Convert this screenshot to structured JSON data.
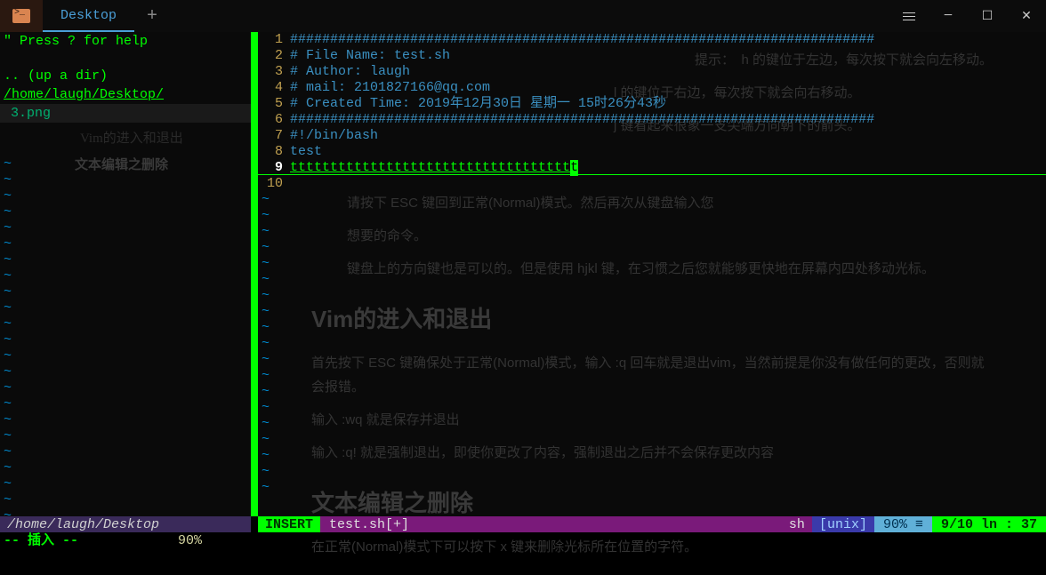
{
  "titlebar": {
    "tab_label": "Desktop",
    "add_symbol": "+"
  },
  "left_pane": {
    "help": "\" Press ? for help",
    "up_dir": ".. (up a dir)",
    "cwd": "/home/laugh/Desktop/",
    "file": "3.png",
    "status_path": "/home/laugh/Desktop",
    "bottom_msg": "-- 插入 --",
    "bottom_pct": "90%"
  },
  "bg_doc": {
    "hint1": "提示：　h 的键位于左边，每次按下就会向左移动。",
    "hint2": "l 的键位于右边，每次按下就会向右移动。",
    "hint3": "j 键看起来很象一支尖端方向朝下的箭头。",
    "nav1": "Vim的进入和退出",
    "nav2": "文本编辑之删除",
    "p1": "请按下 ESC 键回到正常(Normal)模式。然后再次从键盘输入您",
    "p2": "想要的命令。",
    "p3": "键盘上的方向键也是可以的。但是使用 hjkl 键，在习惯之后您就能够更快地在屏幕内四处移动光标。",
    "h2a": "Vim的进入和退出",
    "p4": "首先按下 ESC 键确保处于正常(Normal)模式，输入 :q 回车就是退出vim，当然前提是你没有做任何的更改，否则就会报错。",
    "p5": "输入 :wq 就是保存并退出",
    "p6": "输入 :q! 就是强制退出，即使你更改了内容，强制退出之后并不会保存更改内容",
    "h2b": "文本编辑之删除",
    "p7": "在正常(Normal)模式下可以按下 x 键来删除光标所在位置的字符。"
  },
  "editor": {
    "lines": [
      "#########################################################################",
      "# File Name: test.sh",
      "# Author: laugh",
      "# mail: 2101827166@qq.com",
      "# Created Time: 2019年12月30日 星期一 15时26分43秒",
      "#########################################################################",
      "#!/bin/bash",
      "test",
      "ttttttttttttttttttttttttttttttttttt",
      ""
    ],
    "cursor_char": "t"
  },
  "statusbar": {
    "mode": "INSERT",
    "file": "test.sh[+]",
    "filetype": "sh",
    "format": "[unix]",
    "percent": "90% ≡",
    "position": "9/10 ln : 37"
  }
}
